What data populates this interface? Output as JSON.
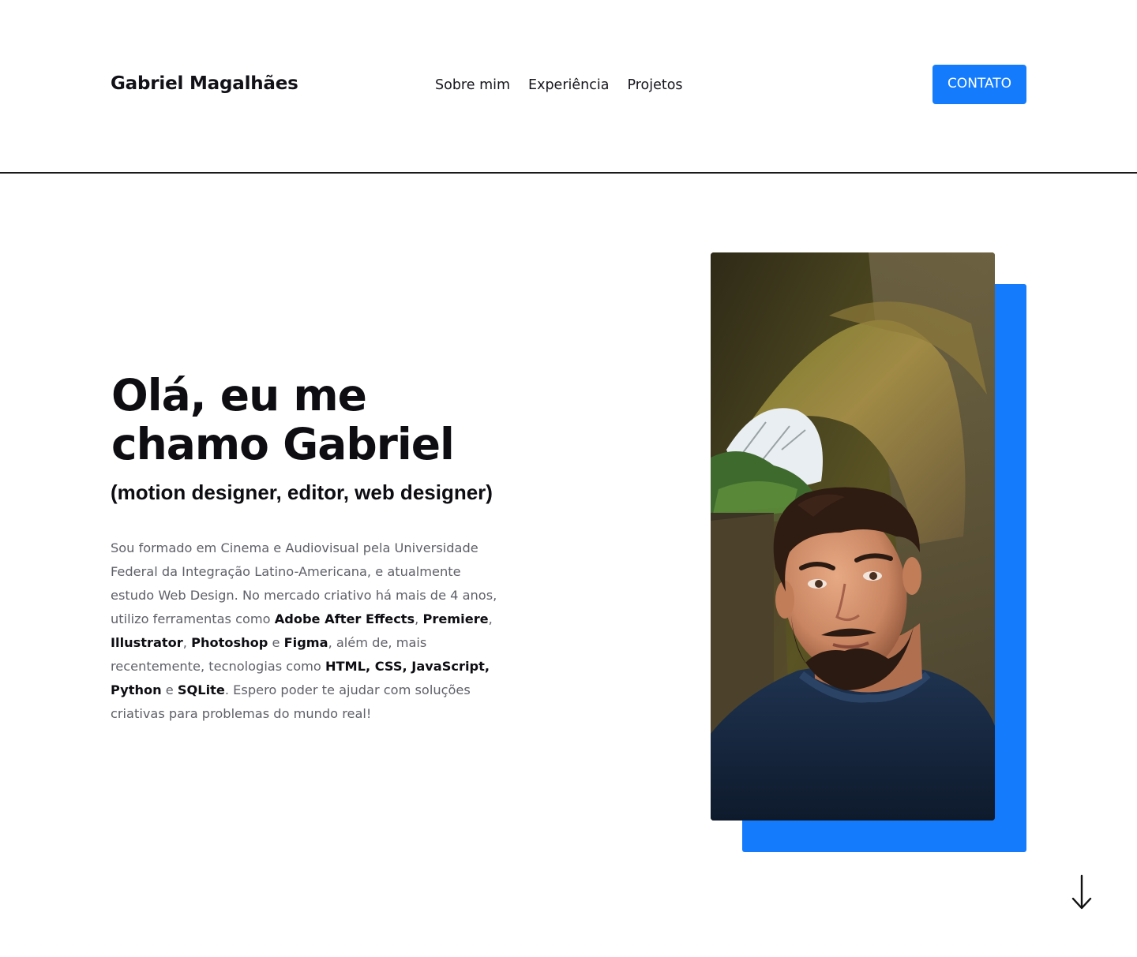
{
  "header": {
    "brand": "Gabriel Magalhães",
    "nav": [
      {
        "label": "Sobre mim"
      },
      {
        "label": "Experiência"
      },
      {
        "label": "Projetos"
      }
    ],
    "contact_label": "CONTATO"
  },
  "hero": {
    "title_line1": "Olá, eu me",
    "title_line2": "chamo Gabriel",
    "subtitle": "(motion designer, editor, web designer)",
    "bio": {
      "p1": "Sou formado em Cinema e Audiovisual pela Universidade Federal da Integração Latino-Americana, e atualmente estudo Web Design. No mercado criativo há mais de 4 anos, utilizo ferramentas como ",
      "t1": "Adobe After Effects",
      "s1": ", ",
      "t2": "Premiere",
      "s2": ", ",
      "t3": "Illustrator",
      "s3": ", ",
      "t4": "Photoshop",
      "s4": " e ",
      "t5": "Figma",
      "p2": ", além de, mais recentemente, tecnologias como ",
      "t6": "HTML, CSS, JavaScript,",
      "s5": " ",
      "t7": "Python",
      "s6": " e ",
      "t8": "SQLite",
      "p3": ". Espero poder te ajudar com soluções criativas para problemas do mundo real!"
    }
  },
  "icons": {
    "scroll": "arrow-down-icon"
  },
  "colors": {
    "accent": "#147cfc",
    "text": "#0d0d12",
    "muted": "#5f6068"
  }
}
